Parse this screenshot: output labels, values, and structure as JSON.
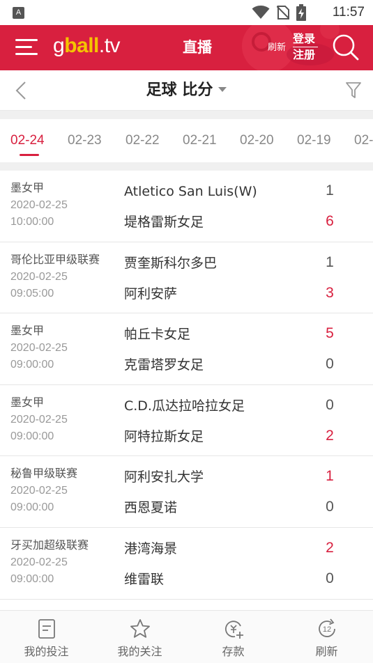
{
  "status_bar": {
    "notification_icon_label": "A",
    "time": "11:57"
  },
  "header": {
    "logo_g": "g",
    "logo_ball": "ball",
    "logo_tv": ".tv",
    "title": "直播",
    "refresh": "刷新",
    "login": "登录",
    "register": "注册",
    "brand_color": "#d8203f"
  },
  "sub_header": {
    "title": "足球 比分"
  },
  "date_tabs": [
    {
      "label": "02-24",
      "active": true
    },
    {
      "label": "02-23",
      "active": false
    },
    {
      "label": "02-22",
      "active": false
    },
    {
      "label": "02-21",
      "active": false
    },
    {
      "label": "02-20",
      "active": false
    },
    {
      "label": "02-19",
      "active": false
    },
    {
      "label": "02-",
      "active": false
    }
  ],
  "matches": [
    {
      "league": "墨女甲",
      "date": "2020-02-25",
      "time": "10:00:00",
      "home": "Atletico San Luis(W)",
      "home_score": "1",
      "away": "堤格雷斯女足",
      "away_score": "6",
      "winner": "away"
    },
    {
      "league": "哥伦比亚甲级联赛",
      "date": "2020-02-25",
      "time": "09:05:00",
      "home": "贾奎斯科尔多巴",
      "home_score": "1",
      "away": "阿利安萨",
      "away_score": "3",
      "winner": "away"
    },
    {
      "league": "墨女甲",
      "date": "2020-02-25",
      "time": "09:00:00",
      "home": "帕丘卡女足",
      "home_score": "5",
      "away": "克雷塔罗女足",
      "away_score": "0",
      "winner": "home"
    },
    {
      "league": "墨女甲",
      "date": "2020-02-25",
      "time": "09:00:00",
      "home": "C.D.瓜达拉哈拉女足",
      "home_score": "0",
      "away": "阿特拉斯女足",
      "away_score": "2",
      "winner": "away"
    },
    {
      "league": "秘鲁甲级联赛",
      "date": "2020-02-25",
      "time": "09:00:00",
      "home": "阿利安扎大学",
      "home_score": "1",
      "away": "西恩夏诺",
      "away_score": "0",
      "winner": "home"
    },
    {
      "league": "牙买加超级联赛",
      "date": "2020-02-25",
      "time": "09:00:00",
      "home": "港湾海景",
      "home_score": "2",
      "away": "维雷联",
      "away_score": "0",
      "winner": "home"
    }
  ],
  "bottom_nav": [
    {
      "label": "我的投注",
      "icon": "betslip-icon"
    },
    {
      "label": "我的关注",
      "icon": "star-icon"
    },
    {
      "label": "存款",
      "icon": "deposit-icon"
    },
    {
      "label": "刷新",
      "icon": "refresh-icon",
      "badge": "12"
    }
  ]
}
